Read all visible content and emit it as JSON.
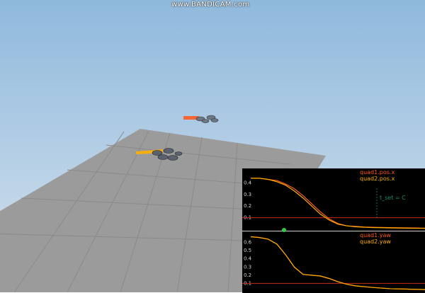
{
  "watermark": {
    "text": "www.BANDICAM.com"
  },
  "colors": {
    "sky_top": "#8fb9dc",
    "sky_bottom": "#d6e2ee",
    "floor": "#9b9b9b",
    "floor_grid": "#8a8a8a",
    "plot_bg": "#000000",
    "quad1": "#ff5a1f",
    "quad2": "#ffb000",
    "threshold": "#cc2a1a",
    "t_set": "#1f8a6a",
    "marker": "#2ecc40"
  },
  "scene": {
    "objects": [
      {
        "name": "quadrotor-1",
        "icon": "quadrotor-icon"
      },
      {
        "name": "quadrotor-2",
        "icon": "quadrotor-icon"
      }
    ]
  },
  "plots": [
    {
      "legend": [
        "quad1.pos.x",
        "quad2.pos.x"
      ],
      "annotation": "t_set = C",
      "chart_data": {
        "type": "line",
        "ylim": [
          0,
          0.5
        ],
        "yticks": [
          "0.4",
          "0.3",
          "0.2",
          "0.1"
        ],
        "threshold": 0.1,
        "series": [
          {
            "name": "quad1.pos.x",
            "x": [
              0,
              0.05,
              0.1,
              0.15,
              0.2,
              0.25,
              0.3,
              0.35,
              0.4,
              0.45,
              0.5,
              0.55,
              0.6,
              0.65,
              0.7,
              0.8,
              0.9,
              1.0
            ],
            "values": [
              0.44,
              0.44,
              0.43,
              0.42,
              0.39,
              0.35,
              0.29,
              0.22,
              0.15,
              0.09,
              0.05,
              0.03,
              0.025,
              0.02,
              0.018,
              0.015,
              0.012,
              0.01
            ]
          },
          {
            "name": "quad2.pos.x",
            "x": [
              0,
              0.05,
              0.1,
              0.15,
              0.2,
              0.25,
              0.3,
              0.35,
              0.4,
              0.45,
              0.5,
              0.55,
              0.6,
              0.65,
              0.7,
              0.8,
              0.9,
              1.0
            ],
            "values": [
              0.44,
              0.44,
              0.43,
              0.41,
              0.38,
              0.33,
              0.27,
              0.2,
              0.13,
              0.08,
              0.045,
              0.03,
              0.022,
              0.018,
              0.015,
              0.012,
              0.01,
              0.008
            ]
          }
        ]
      }
    },
    {
      "legend": [
        "quad1.yaw",
        "quad2.yaw"
      ],
      "chart_data": {
        "type": "line",
        "ylim": [
          0,
          0.7
        ],
        "yticks": [
          "0.6",
          "0.5",
          "0.4",
          "0.3",
          "0.2",
          "0.1"
        ],
        "threshold": 0.1,
        "series": [
          {
            "name": "quad1.yaw",
            "x": [
              0,
              0.05,
              0.1,
              0.15,
              0.2,
              0.25,
              0.3,
              0.35,
              0.4,
              0.45,
              0.5,
              0.55,
              0.6,
              0.65,
              0.7,
              0.8,
              0.9,
              1.0
            ],
            "values": [
              0.67,
              0.66,
              0.64,
              0.58,
              0.45,
              0.3,
              0.21,
              0.2,
              0.19,
              0.16,
              0.12,
              0.09,
              0.07,
              0.06,
              0.05,
              0.035,
              0.03,
              0.025
            ]
          },
          {
            "name": "quad2.yaw",
            "x": [
              0,
              0.05,
              0.1,
              0.15,
              0.2,
              0.25,
              0.3,
              0.35,
              0.4,
              0.45,
              0.5,
              0.55,
              0.6,
              0.65,
              0.7,
              0.8,
              0.9,
              1.0
            ],
            "values": [
              0.67,
              0.66,
              0.64,
              0.58,
              0.45,
              0.3,
              0.21,
              0.2,
              0.19,
              0.16,
              0.12,
              0.09,
              0.07,
              0.06,
              0.05,
              0.035,
              0.03,
              0.025
            ]
          }
        ]
      }
    }
  ]
}
